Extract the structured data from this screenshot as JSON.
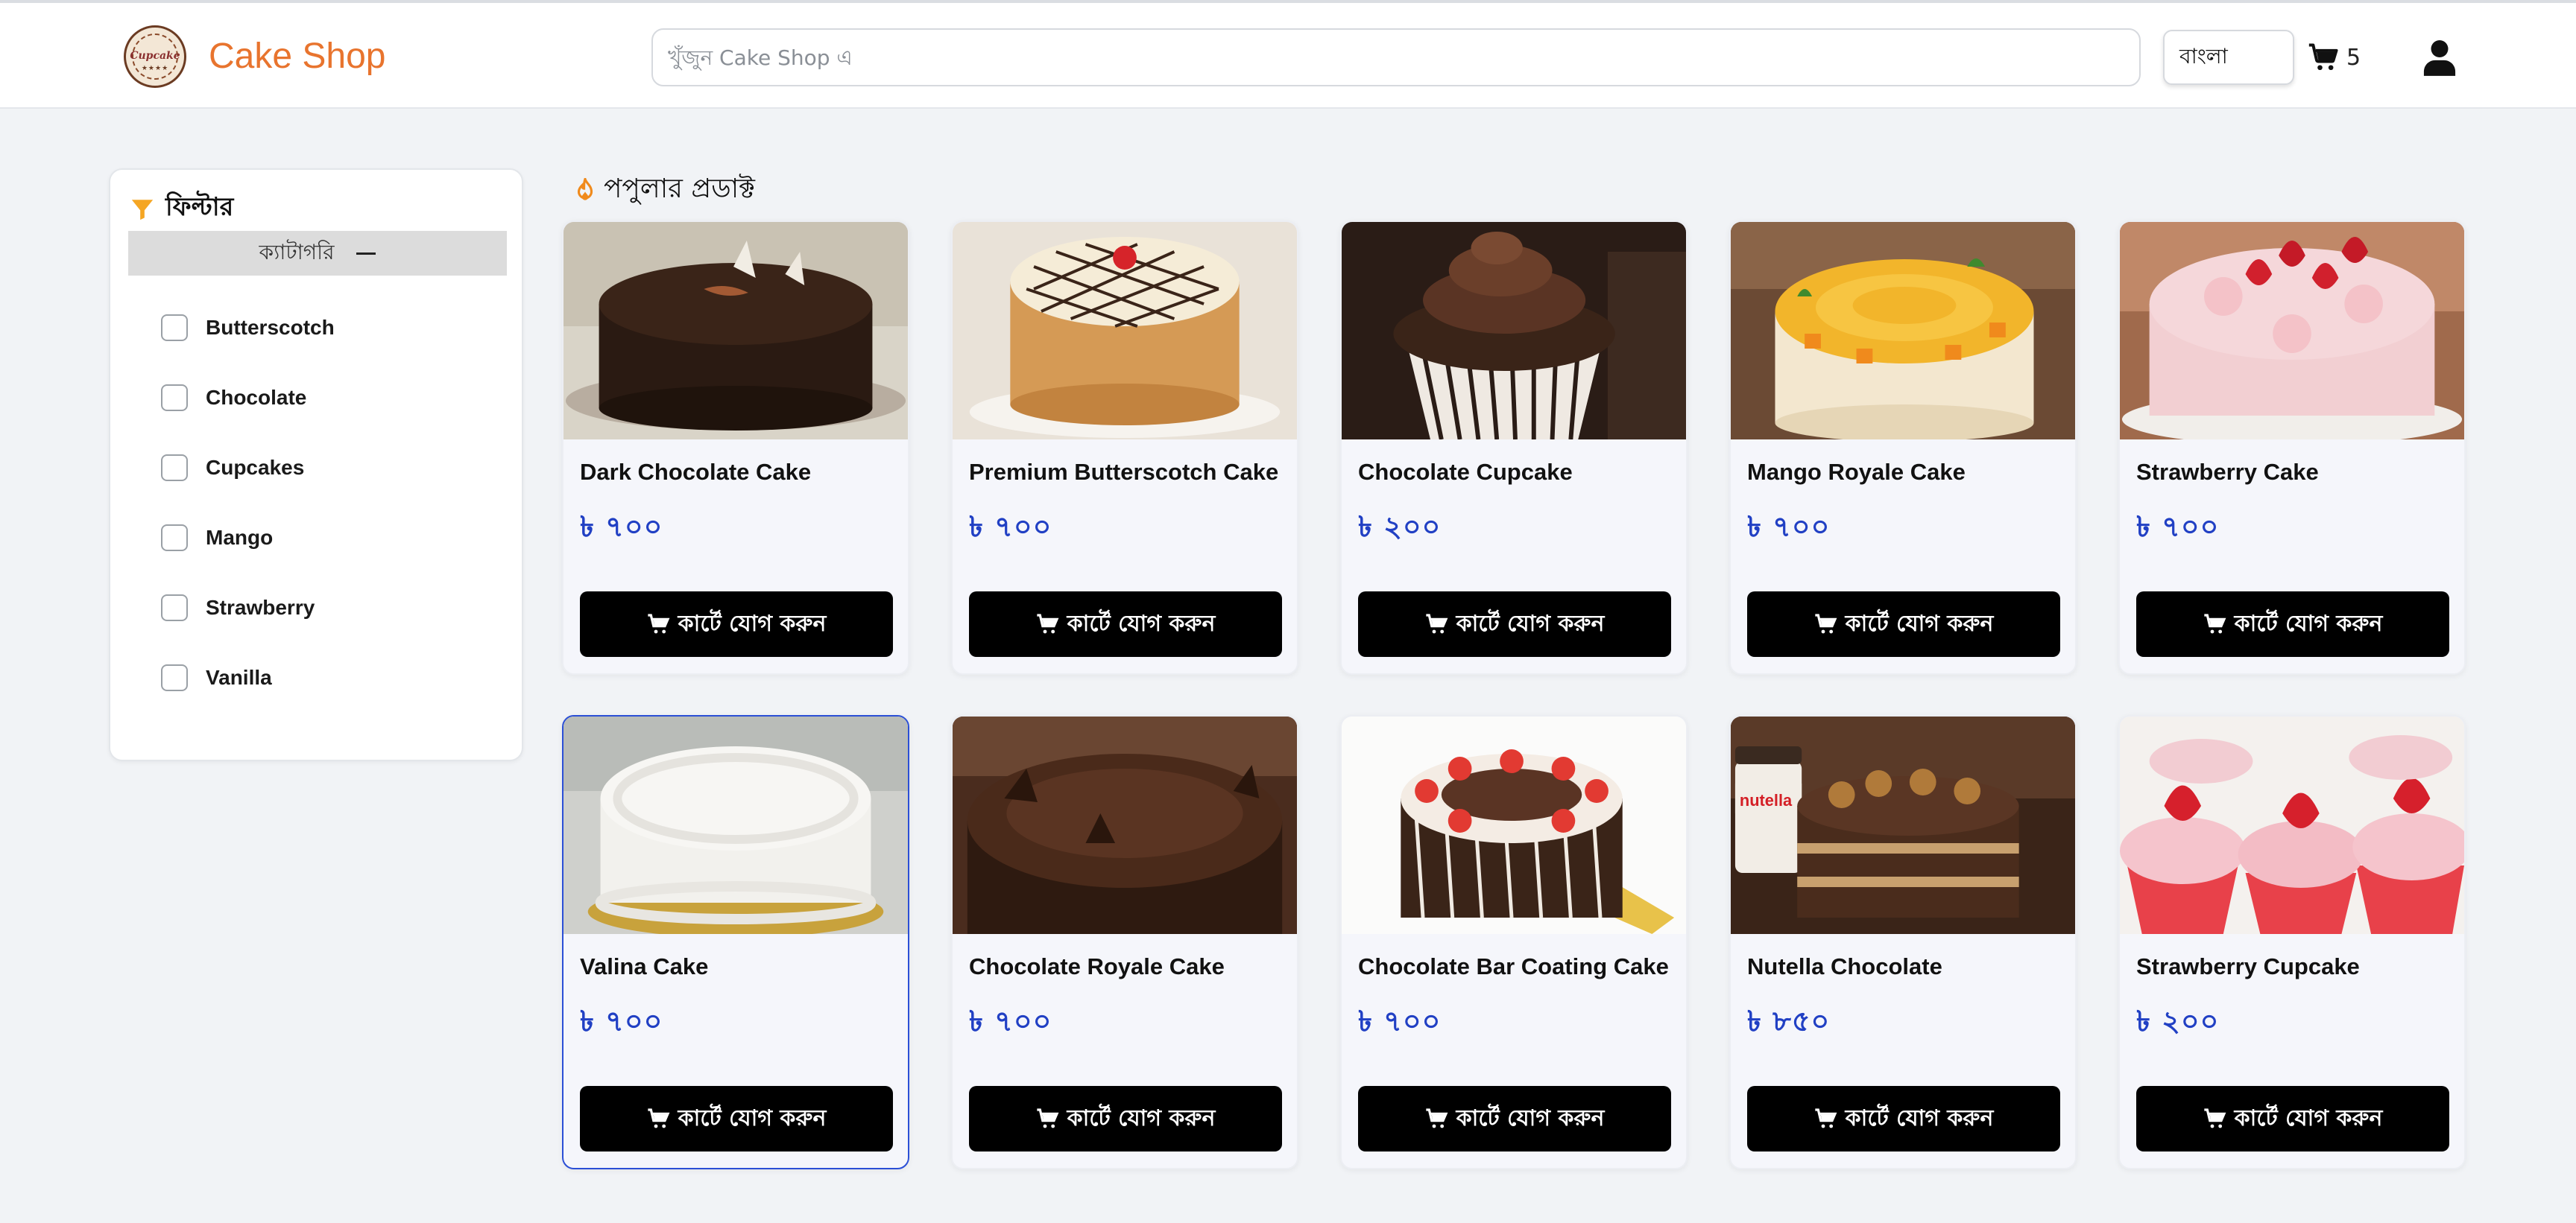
{
  "header": {
    "logo_text": "Cupcake",
    "brand": "Cake Shop",
    "search_placeholder": "খুঁজুন Cake Shop এ",
    "language": "বাংলা",
    "cart_count": "5"
  },
  "sidebar": {
    "title": "ফিল্টার",
    "category_label": "ক্যাটাগরি",
    "categories": [
      "Butterscotch",
      "Chocolate",
      "Cupcakes",
      "Mango",
      "Strawberry",
      "Vanilla"
    ]
  },
  "section_title": "পপুলার প্রডাক্ট",
  "add_to_cart_label": "কার্টে যোগ করুন",
  "products": [
    {
      "name": "Dark Chocolate Cake",
      "price": "৳ ৭০০"
    },
    {
      "name": "Premium Butterscotch Cake",
      "price": "৳ ৭০০"
    },
    {
      "name": "Chocolate Cupcake",
      "price": "৳ ২০০"
    },
    {
      "name": "Mango Royale Cake",
      "price": "৳ ৭০০"
    },
    {
      "name": "Strawberry Cake",
      "price": "৳ ৭০০"
    },
    {
      "name": "Valina Cake",
      "price": "৳ ৭০০"
    },
    {
      "name": "Chocolate Royale Cake",
      "price": "৳ ৭০০"
    },
    {
      "name": "Chocolate Bar Coating Cake",
      "price": "৳ ৭০০"
    },
    {
      "name": "Nutella Chocolate",
      "price": "৳ ৮৫০"
    },
    {
      "name": "Strawberry Cupcake",
      "price": "৳ ২০০"
    }
  ],
  "colors": {
    "brand": "#e8742e",
    "price": "#2140c4",
    "button": "#000000",
    "selected_border": "#2b4fd6",
    "filter_icon": "#f5a623"
  },
  "icons": {
    "cart": "cart-icon",
    "user": "user-icon",
    "filter": "filter-icon",
    "popular": "fire-icon"
  }
}
